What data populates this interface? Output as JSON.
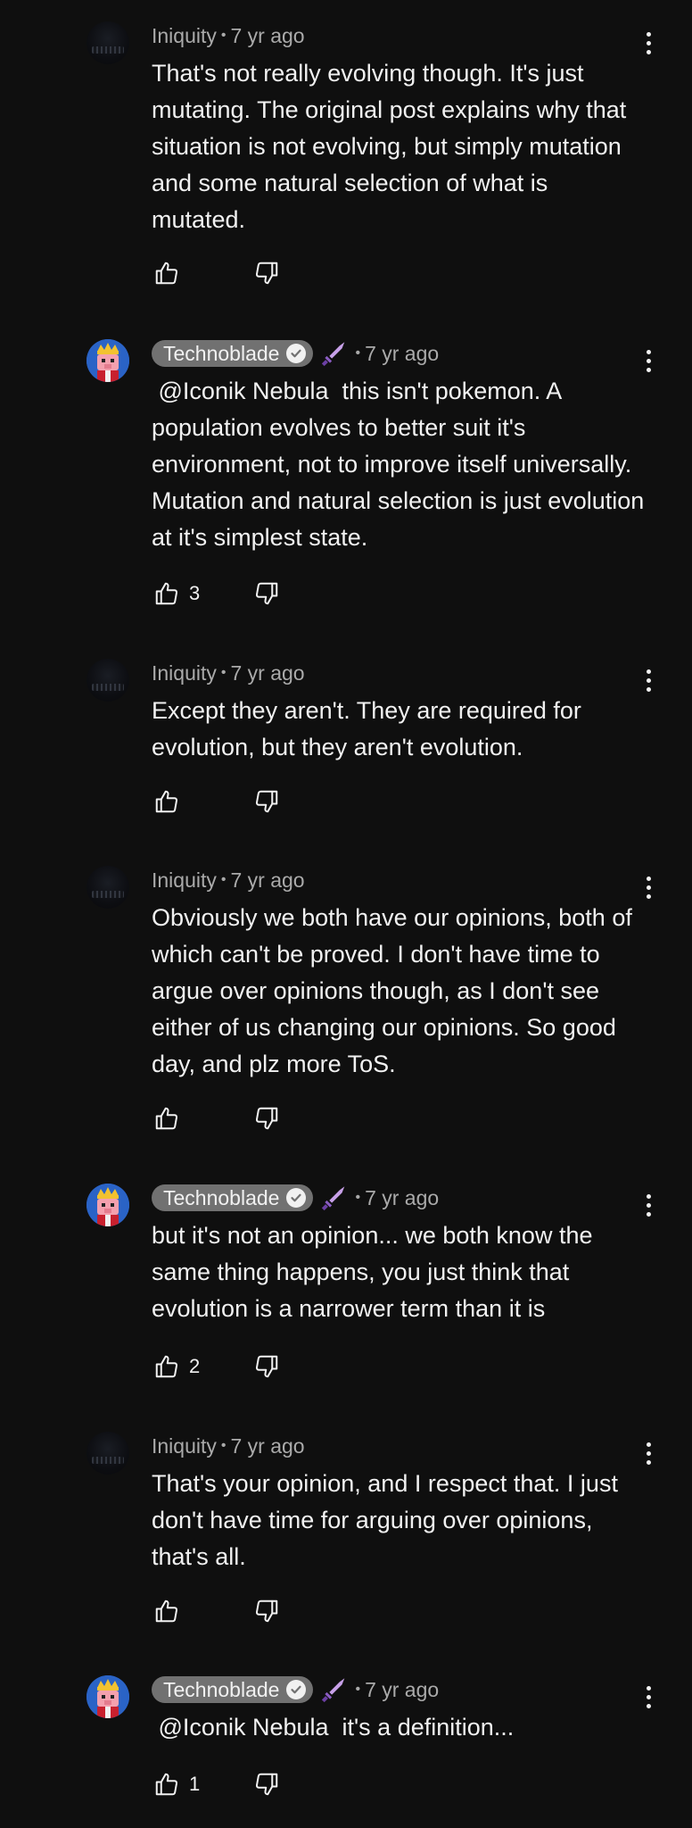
{
  "comments": [
    {
      "author": "Iniquity",
      "verified_pill": false,
      "time": "7 yr ago",
      "text": "That's not really evolving though. It's just mutating. The original post explains why that situation is not evolving, but simply mutation and some natural selection of what is mutated.",
      "likes": ""
    },
    {
      "author": "Technoblade",
      "verified_pill": true,
      "time": "7 yr ago",
      "text": " @Iconik Nebula  this isn't pokemon. A population evolves to better suit it's environment, not to improve itself universally. Mutation and natural selection is just evolution at it's simplest state.",
      "likes": "3"
    },
    {
      "author": "Iniquity",
      "verified_pill": false,
      "time": "7 yr ago",
      "text": "Except they aren't. They are required for evolution, but they aren't evolution.",
      "likes": ""
    },
    {
      "author": "Iniquity",
      "verified_pill": false,
      "time": "7 yr ago",
      "text": "Obviously we both have our opinions, both of which can't be proved. I don't have time to argue over opinions though, as I don't see either of us changing our opinions. So good day, and plz more ToS.",
      "likes": ""
    },
    {
      "author": "Technoblade",
      "verified_pill": true,
      "time": "7 yr ago",
      "text": "but it's not an opinion... we both know the same thing happens, you just think that evolution is a narrower term than it is",
      "likes": "2"
    },
    {
      "author": "Iniquity",
      "verified_pill": false,
      "time": "7 yr ago",
      "text": "That's your opinion, and I respect that. I just don't have time for arguing over opinions, that's all.",
      "likes": ""
    },
    {
      "author": "Technoblade",
      "verified_pill": true,
      "time": "7 yr ago",
      "text": " @Iconik Nebula  it's a definition...",
      "likes": "1"
    }
  ],
  "separator": "•",
  "colors": {
    "background": "#0f0f0f",
    "text": "#f1f1f1",
    "meta": "#aaaaaa",
    "pill": "#717171",
    "sword": "#c7a0e8"
  },
  "icons": {
    "like": "thumbs-up-icon",
    "dislike": "thumbs-down-icon",
    "more": "more-vert-icon",
    "verified": "verified-check-icon",
    "badge": "sword-badge-icon"
  }
}
